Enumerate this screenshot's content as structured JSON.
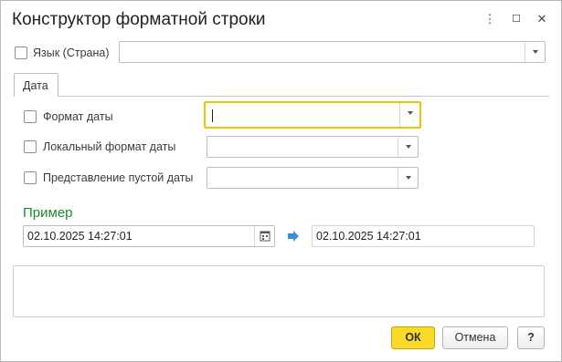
{
  "window": {
    "title": "Конструктор форматной строки",
    "more_label": "⋮",
    "maximize_label": "☐",
    "close_label": "✕"
  },
  "language": {
    "label": "Язык (Страна)",
    "checked": false,
    "value": ""
  },
  "tabs": [
    {
      "label": "Дата",
      "active": true
    }
  ],
  "date_tab": {
    "date_format": {
      "label": "Формат даты",
      "checked": false,
      "value": ""
    },
    "local_date_format": {
      "label": "Локальный формат даты",
      "checked": false,
      "value": ""
    },
    "empty_date_repr": {
      "label": "Представление пустой даты",
      "checked": false,
      "value": ""
    }
  },
  "example": {
    "title": "Пример",
    "input_value": "02.10.2025 14:27:01",
    "output_value": "02.10.2025 14:27:01"
  },
  "footer": {
    "ok_label": "ОК",
    "cancel_label": "Отмена",
    "help_label": "?"
  },
  "colors": {
    "accent_focus": "#f2c200",
    "ok_button": "#f9da28",
    "section_title": "#1d8b2a",
    "arrow_icon": "#3b8fd9"
  },
  "icons": {
    "calendar": "calendar-icon",
    "arrow": "arrow-right-icon",
    "dropdown": "chevron-down-icon"
  }
}
